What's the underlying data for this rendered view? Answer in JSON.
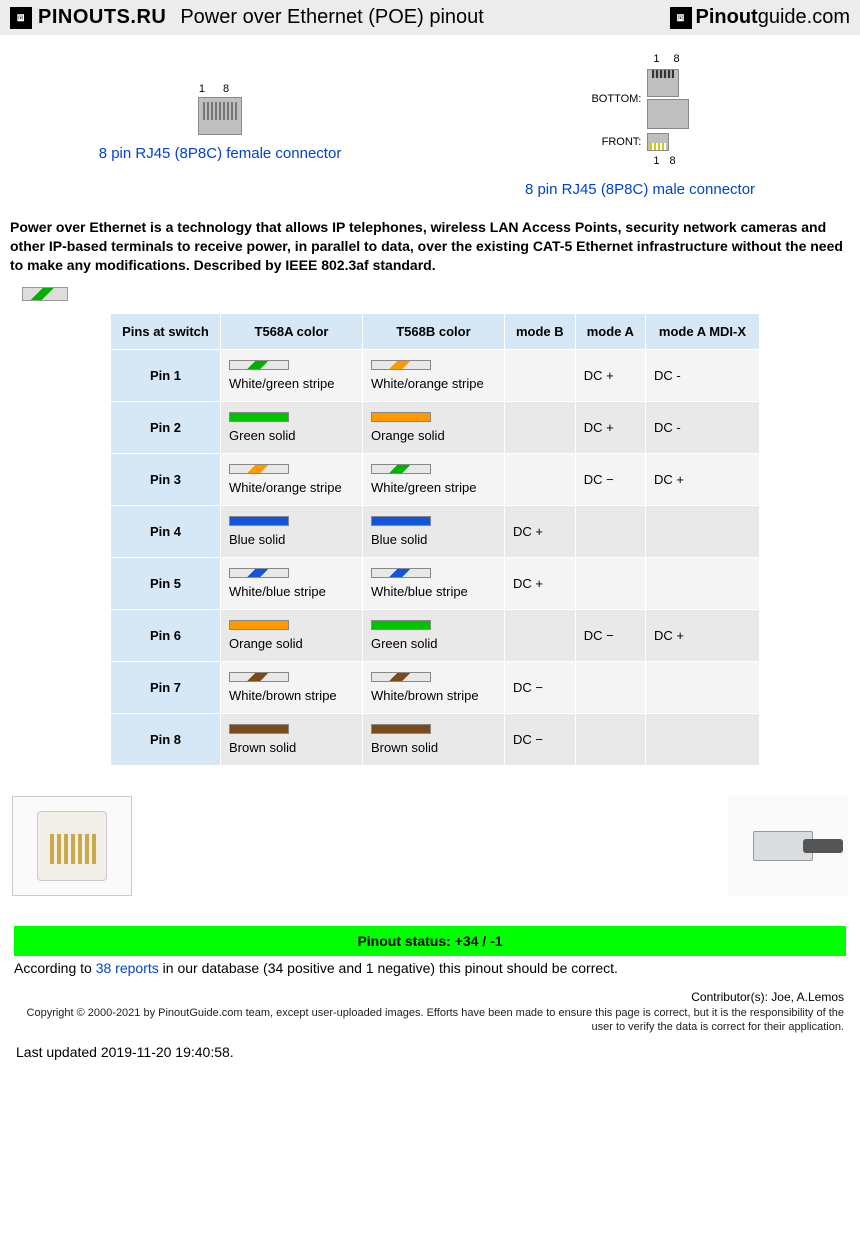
{
  "header": {
    "logo_left": "PINOUTS.RU",
    "title": "Power over Ethernet (POE) pinout",
    "logo_right_prefix": "Pinout",
    "logo_right_suffix": "guide.com"
  },
  "connectors": {
    "female": {
      "pin_lo": "1",
      "pin_hi": "8",
      "link": "8 pin RJ45 (8P8C) female connector"
    },
    "male": {
      "bottom_label": "BOTTOM:",
      "front_label": "FRONT:",
      "pin_lo": "1",
      "pin_hi": "8",
      "link": "8 pin RJ45 (8P8C) male connector"
    }
  },
  "intro": "Power over Ethernet is a technology that allows IP telephones, wireless LAN Access Points, security network cameras and other IP-based terminals to receive power, in parallel to data, over the existing CAT-5 Ethernet infrastructure without the need to make any modifications. Described by IEEE 802.3af standard.",
  "table": {
    "headers": [
      "Pins at switch",
      "T568A color",
      "T568B color",
      "mode B",
      "mode A",
      "mode A MDI-X"
    ],
    "rows": [
      {
        "pin": "Pin 1",
        "a": {
          "label": "White/green stripe",
          "cls": "sw-wg"
        },
        "b": {
          "label": "White/orange stripe",
          "cls": "sw-wo"
        },
        "modeB": "",
        "modeA": "DC +",
        "modeAm": "DC -"
      },
      {
        "pin": "Pin 2",
        "a": {
          "label": "Green solid",
          "cls": "sw-g"
        },
        "b": {
          "label": "Orange solid",
          "cls": "sw-o"
        },
        "modeB": "",
        "modeA": "DC +",
        "modeAm": "DC -"
      },
      {
        "pin": "Pin 3",
        "a": {
          "label": "White/orange stripe",
          "cls": "sw-wo"
        },
        "b": {
          "label": "White/green stripe",
          "cls": "sw-wg"
        },
        "modeB": "",
        "modeA": "DC −",
        "modeAm": "DC +"
      },
      {
        "pin": "Pin 4",
        "a": {
          "label": "Blue solid",
          "cls": "sw-b"
        },
        "b": {
          "label": "Blue solid",
          "cls": "sw-b"
        },
        "modeB": "DC +",
        "modeA": "",
        "modeAm": ""
      },
      {
        "pin": "Pin 5",
        "a": {
          "label": "White/blue stripe",
          "cls": "sw-wb"
        },
        "b": {
          "label": "White/blue stripe",
          "cls": "sw-wb"
        },
        "modeB": "DC +",
        "modeA": "",
        "modeAm": ""
      },
      {
        "pin": "Pin 6",
        "a": {
          "label": "Orange solid",
          "cls": "sw-o"
        },
        "b": {
          "label": "Green solid",
          "cls": "sw-g"
        },
        "modeB": "",
        "modeA": "DC −",
        "modeAm": "DC +"
      },
      {
        "pin": "Pin 7",
        "a": {
          "label": "White/brown stripe",
          "cls": "sw-wbr"
        },
        "b": {
          "label": "White/brown stripe",
          "cls": "sw-wbr"
        },
        "modeB": "DC −",
        "modeA": "",
        "modeAm": ""
      },
      {
        "pin": "Pin 8",
        "a": {
          "label": "Brown solid",
          "cls": "sw-br"
        },
        "b": {
          "label": "Brown solid",
          "cls": "sw-br"
        },
        "modeB": "DC −",
        "modeA": "",
        "modeAm": ""
      }
    ]
  },
  "status": {
    "bar": "Pinout status: +34 / -1",
    "before_link": "According to ",
    "link": "38 reports",
    "after_link": " in our database (34 positive and 1 negative) this pinout should be correct."
  },
  "contributors": "Contributor(s): Joe, A.Lemos",
  "copyright": "Copyright © 2000-2021 by PinoutGuide.com team, except user-uploaded images. Efforts have been made to ensure this page is correct, but it is the responsibility of the user to verify the data is correct for their application.",
  "updated": "Last updated 2019-11-20 19:40:58."
}
